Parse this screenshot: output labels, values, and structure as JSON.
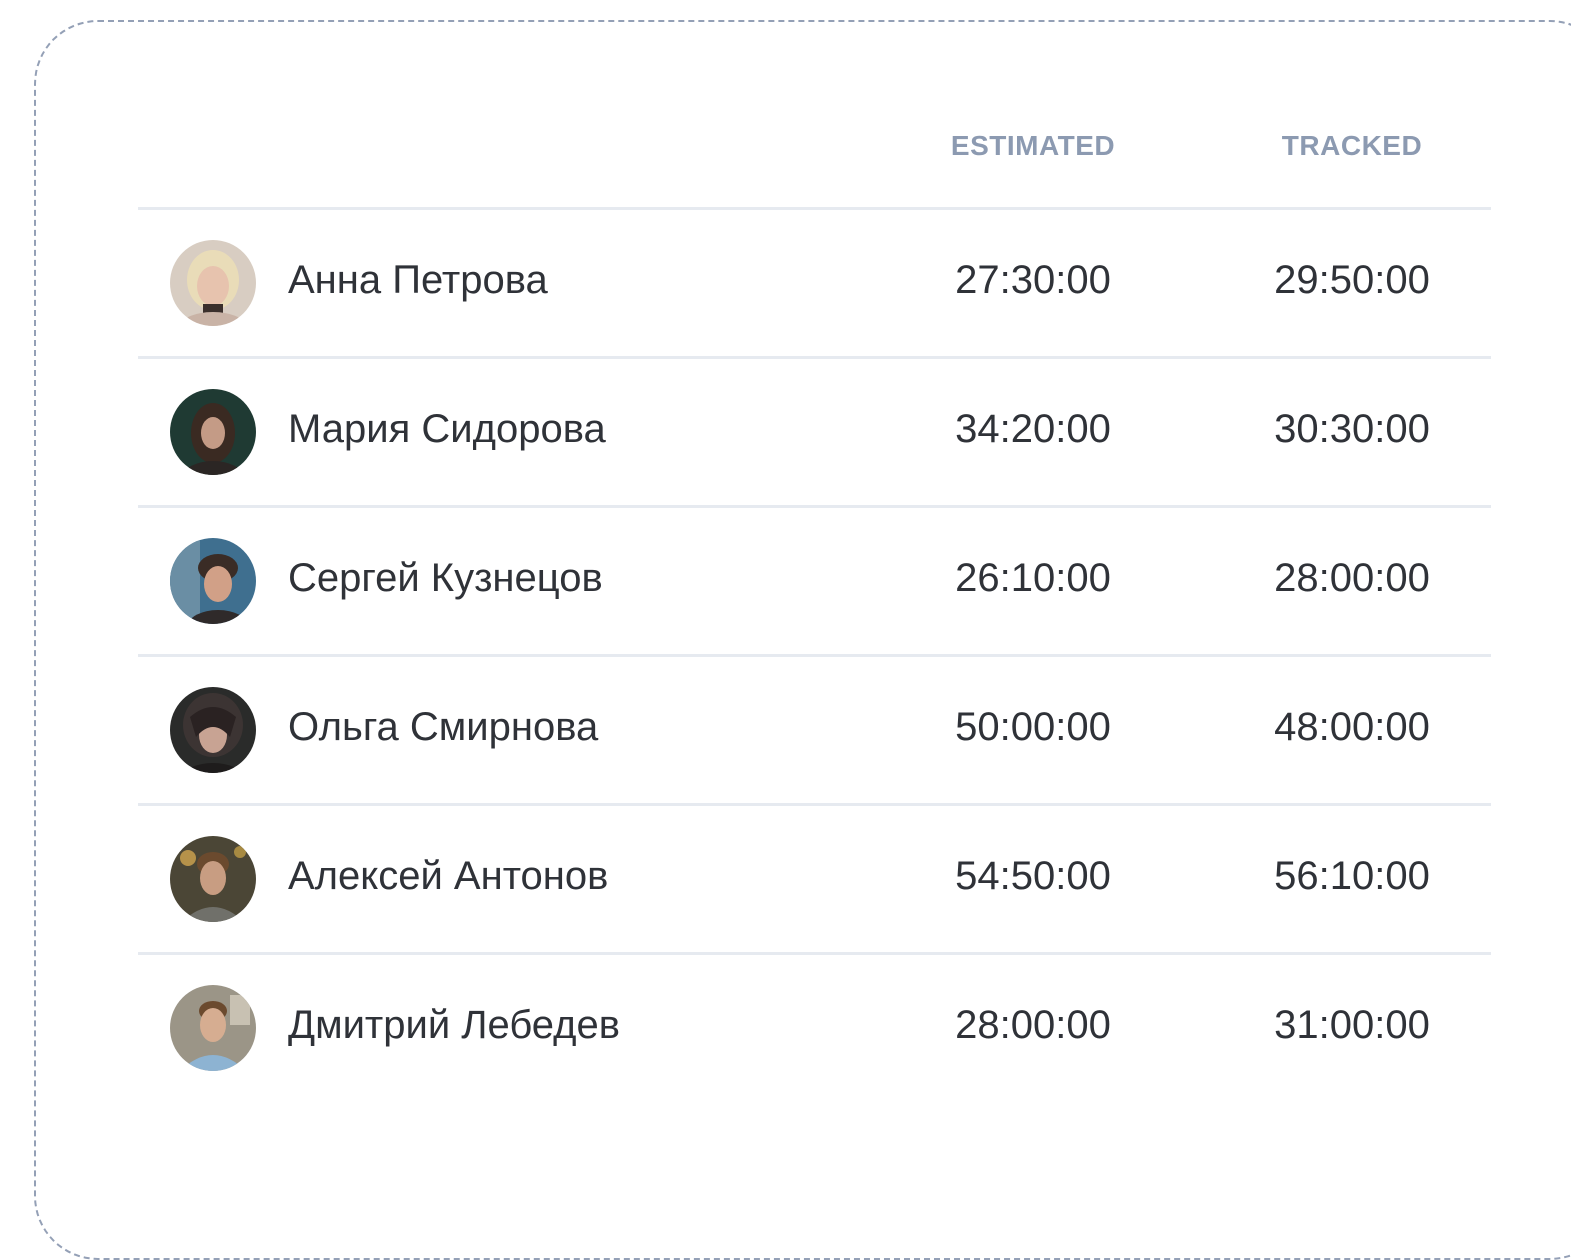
{
  "table": {
    "headers": {
      "estimated": "ESTIMATED",
      "tracked": "TRACKED"
    },
    "rows": [
      {
        "avatar_icon": "avatar-photo-icon",
        "name": "Анна Петрова",
        "estimated": "27:30:00",
        "tracked": "29:50:00"
      },
      {
        "avatar_icon": "avatar-photo-icon",
        "name": "Мария Сидорова",
        "estimated": "34:20:00",
        "tracked": "30:30:00"
      },
      {
        "avatar_icon": "avatar-photo-icon",
        "name": "Сергей Кузнецов",
        "estimated": "26:10:00",
        "tracked": "28:00:00"
      },
      {
        "avatar_icon": "avatar-photo-icon",
        "name": "Ольга Смирнова",
        "estimated": "50:00:00",
        "tracked": "48:00:00"
      },
      {
        "avatar_icon": "avatar-photo-icon",
        "name": "Алексей Антонов",
        "estimated": "54:50:00",
        "tracked": "56:10:00"
      },
      {
        "avatar_icon": "avatar-photo-icon",
        "name": "Дмитрий Лебедев",
        "estimated": "28:00:00",
        "tracked": "31:00:00"
      }
    ]
  },
  "colors": {
    "header_text": "#8c9ab1",
    "body_text": "#2f3238",
    "divider": "#e6eaf0",
    "frame_border": "#94a0b6"
  }
}
